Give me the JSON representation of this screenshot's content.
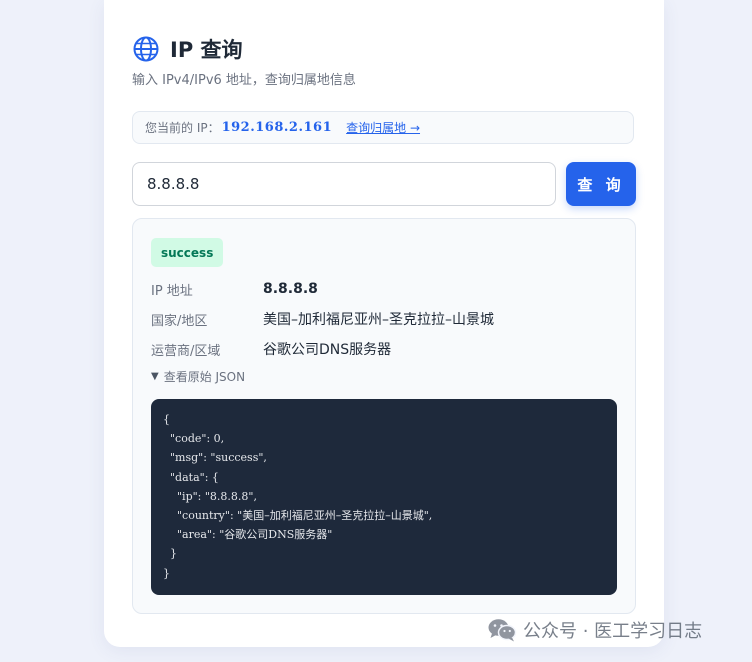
{
  "header": {
    "title": "IP 查询",
    "subtitle": "输入 IPv4/IPv6 地址，查询归属地信息"
  },
  "current_ip": {
    "label": "您当前的 IP：",
    "value": "192.168.2.161",
    "link": "查询归属地 →"
  },
  "search": {
    "value": "8.8.8.8",
    "button_label": "查 询"
  },
  "result": {
    "status": "success",
    "rows": [
      {
        "label": "IP 地址",
        "value": "8.8.8.8"
      },
      {
        "label": "国家/地区",
        "value": "美国–加利福尼亚州–圣克拉拉–山景城"
      },
      {
        "label": "运营商/区域",
        "value": "谷歌公司DNS服务器"
      }
    ],
    "raw_toggle": "查看原始 JSON",
    "raw_json": "{\n  \"code\": 0,\n  \"msg\": \"success\",\n  \"data\": {\n    \"ip\": \"8.8.8.8\",\n    \"country\": \"美国–加利福尼亚州–圣克拉拉–山景城\",\n    \"area\": \"谷歌公司DNS服务器\"\n  }\n}"
  },
  "watermark": {
    "text": "公众号 · 医工学习日志"
  },
  "icons": {
    "title": "globe-icon",
    "watermark": "wechat-icon",
    "toggle": "triangle-down-icon"
  },
  "colors": {
    "accent": "#2563eb",
    "success_bg": "#d1fae5",
    "success_text": "#047857",
    "code_bg": "#1e293b"
  }
}
